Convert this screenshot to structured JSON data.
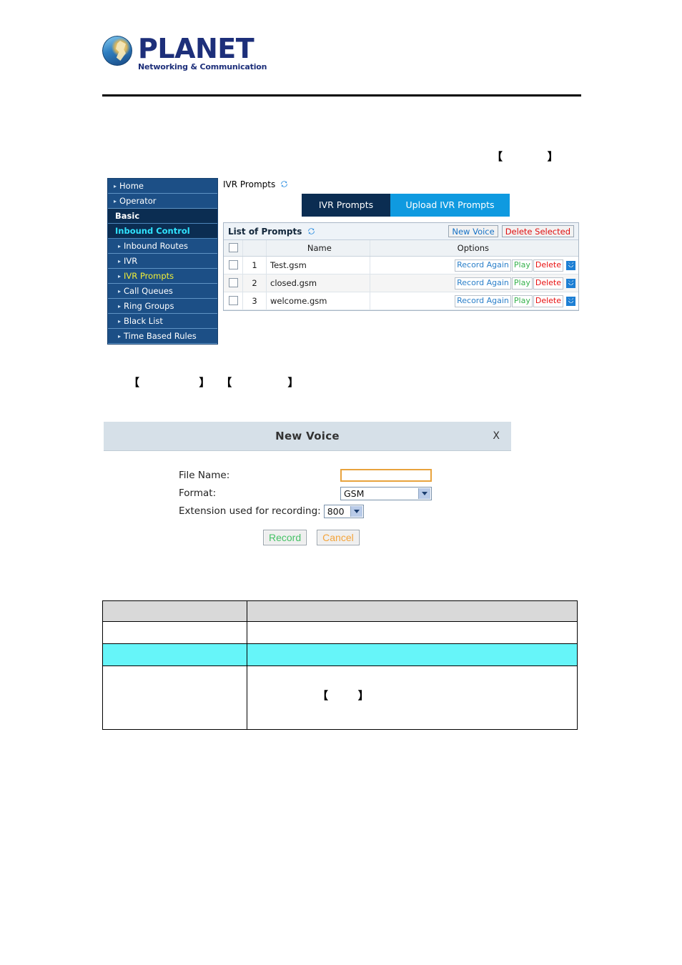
{
  "header": {
    "brand_name": "PLANET",
    "brand_tagline": "Networking & Communication",
    "logo_icon": "planet-globe-logo"
  },
  "annotations": {
    "bracket_top": "【            】",
    "bracket_mid": "【                】   【               】",
    "bracket_table": "【        】"
  },
  "screenshot_ivr": {
    "sidebar": {
      "items": [
        {
          "label": "Home",
          "type": "link",
          "arrow": "›"
        },
        {
          "label": "Operator",
          "type": "link",
          "arrow": "›"
        },
        {
          "label": "Basic",
          "type": "section",
          "arrow": ""
        },
        {
          "label": "Inbound Control",
          "type": "section-active",
          "arrow": ""
        },
        {
          "label": "Inbound Routes",
          "type": "sub",
          "arrow": "›"
        },
        {
          "label": "IVR",
          "type": "sub",
          "arrow": "›"
        },
        {
          "label": "IVR Prompts",
          "type": "sub-current",
          "arrow": "›"
        },
        {
          "label": "Call Queues",
          "type": "sub",
          "arrow": "›"
        },
        {
          "label": "Ring Groups",
          "type": "sub",
          "arrow": "›"
        },
        {
          "label": "Black List",
          "type": "sub",
          "arrow": "›"
        },
        {
          "label": "Time Based Rules",
          "type": "sub",
          "arrow": "›"
        }
      ]
    },
    "page_title": "IVR Prompts",
    "page_title_icon": "refresh-icon",
    "tabs": [
      {
        "label": "IVR Prompts",
        "active": true
      },
      {
        "label": "Upload IVR Prompts",
        "active": false
      }
    ],
    "panel": {
      "title": "List of Prompts",
      "title_icon": "refresh-icon",
      "buttons": [
        {
          "label": "New Voice",
          "color": "#1571c6"
        },
        {
          "label": "Delete Selected",
          "color": "#e01010"
        }
      ],
      "columns": {
        "select": "",
        "index": "",
        "name": "Name",
        "options": "Options"
      },
      "rows": [
        {
          "index": "1",
          "name": "Test.gsm",
          "options": [
            "Record Again",
            "Play",
            "Delete"
          ],
          "download_icon": "download-icon"
        },
        {
          "index": "2",
          "name": "closed.gsm",
          "options": [
            "Record Again",
            "Play",
            "Delete"
          ],
          "download_icon": "download-icon"
        },
        {
          "index": "3",
          "name": "welcome.gsm",
          "options": [
            "Record Again",
            "Play",
            "Delete"
          ],
          "download_icon": "download-icon"
        }
      ]
    }
  },
  "dialog_new_voice": {
    "title": "New Voice",
    "close_label": "X",
    "fields": {
      "file_name_label": "File Name:",
      "file_name_value": "",
      "format_label": "Format:",
      "format_value": "GSM",
      "extension_label": "Extension used for recording:",
      "extension_value": "800"
    },
    "buttons": {
      "record": "Record",
      "cancel": "Cancel"
    }
  },
  "description_table": {
    "header": {
      "col1": "",
      "col2": ""
    },
    "rows": [
      {
        "col1": "",
        "col2": "",
        "style": "plain"
      },
      {
        "col1": "",
        "col2": "",
        "style": "cyan"
      },
      {
        "col1": "",
        "col2": "",
        "style": "tall"
      }
    ]
  },
  "colors": {
    "sidebar_bg": "#1c4f86",
    "sidebar_section_bg": "#0b2d52",
    "sidebar_active_text": "#2fe3ff",
    "sidebar_current_text": "#f2ef36",
    "tab_active_bg": "#0b2d52",
    "tab_inactive_bg": "#0f9ae0",
    "panel_header_bg": "#eef3f8",
    "dialog_titlebar_bg": "#d6e0e8",
    "input_border": "#e8a33d",
    "link_blue": "#2a7fc9",
    "link_green": "#37b24d",
    "link_red": "#e81010",
    "table_header_gray": "#d9d9d9",
    "table_highlight_cyan": "#66f5f9"
  }
}
